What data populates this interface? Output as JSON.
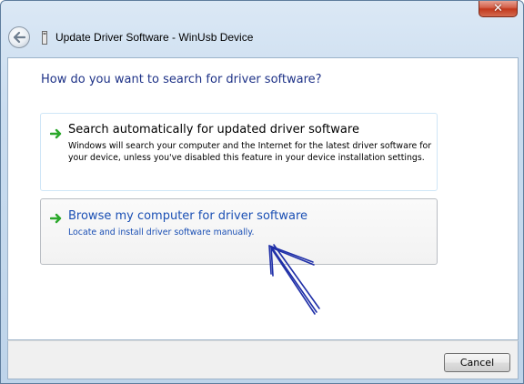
{
  "window": {
    "title": "Update Driver Software - WinUsb Device",
    "close_glyph": "✕",
    "icons": {
      "back": "back-arrow-icon",
      "device": "device-icon",
      "close": "close-icon"
    }
  },
  "main": {
    "heading": "How do you want to search for driver software?",
    "options": [
      {
        "title": "Search automatically for updated driver software",
        "description": "Windows will search your computer and the Internet for the latest driver software for your device, unless you've disabled this feature in your device installation settings.",
        "icon": "green-arrow-icon"
      },
      {
        "title": "Browse my computer for driver software",
        "description": "Locate and install driver software manually.",
        "icon": "green-arrow-icon"
      }
    ]
  },
  "footer": {
    "cancel_label": "Cancel"
  },
  "colors": {
    "heading": "#1e3287",
    "link_text": "#1a4fb4",
    "arrow_green": "#2aa82a",
    "annotation": "#1f2fa8"
  }
}
